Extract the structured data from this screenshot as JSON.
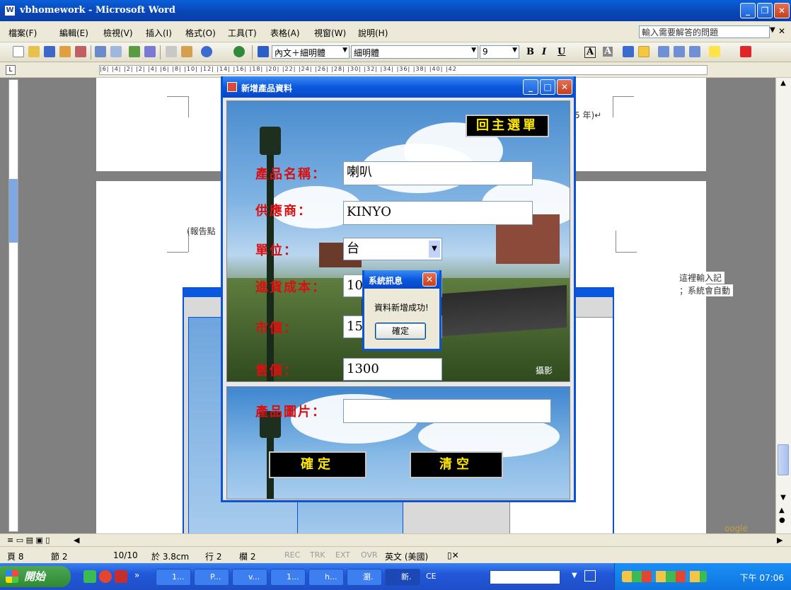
{
  "word": {
    "title": "vbhomework - Microsoft Word",
    "menus": [
      "檔案(F)",
      "編輯(E)",
      "檢視(V)",
      "插入(I)",
      "格式(O)",
      "工具(T)",
      "表格(A)",
      "視窗(W)",
      "說明(H)"
    ],
    "help_placeholder": "輸入需要解答的問題",
    "style_combo": "內文＋細明體",
    "font_combo": "細明體",
    "size_combo": "9",
    "ruler_text": "|6|  |4|  |2|     |2|  |4|  |6|  |8|  |10|  |12|  |14|  |16|  |18|  |20|  |22|  |24|  |26|  |28|  |30|  |32|  |34|  |36|  |38|  |40|  |42"
  },
  "document": {
    "year_fragment": "5 年)↵",
    "report_fragment": "(報告點",
    "side_line1": "這裡輸入記",
    "side_line2": "；系統會自動",
    "google_fragment": "oogle"
  },
  "form": {
    "title": "新增產品資料",
    "back_button": "回主選單",
    "product_name_label": "產品名稱：",
    "product_name_value": "喇叭",
    "supplier_label": "供應商：",
    "supplier_value": "KINYO",
    "unit_label": "單位：",
    "unit_value": "台",
    "cost_label": "進貨成本：",
    "cost_value": "10",
    "market_price_label": "市價：",
    "market_price_value": "15",
    "sale_price_label": "售價：",
    "sale_price_value": "1300",
    "photo_label": "產品圖片：",
    "photo_value": "",
    "photo_caption": "攝影",
    "confirm_button": "確定",
    "clear_button": "清空"
  },
  "msgbox": {
    "title": "系統訊息",
    "message": "資料新增成功!",
    "ok_button": "確定"
  },
  "status": {
    "page": "頁 8",
    "section": "節 2",
    "page_count": "10/10",
    "position": "於 3.8cm",
    "line": "行 2",
    "column": "欄 2",
    "rec": "REC",
    "trk": "TRK",
    "ext": "EXT",
    "ovr": "OVR",
    "language": "英文 (美國)"
  },
  "taskbar": {
    "start": "開始",
    "buttons": [
      "1...",
      "P...",
      "v...",
      "1...",
      "h...",
      "瀏.",
      "新.",
      "CE"
    ],
    "clock": "下午 07:06"
  }
}
